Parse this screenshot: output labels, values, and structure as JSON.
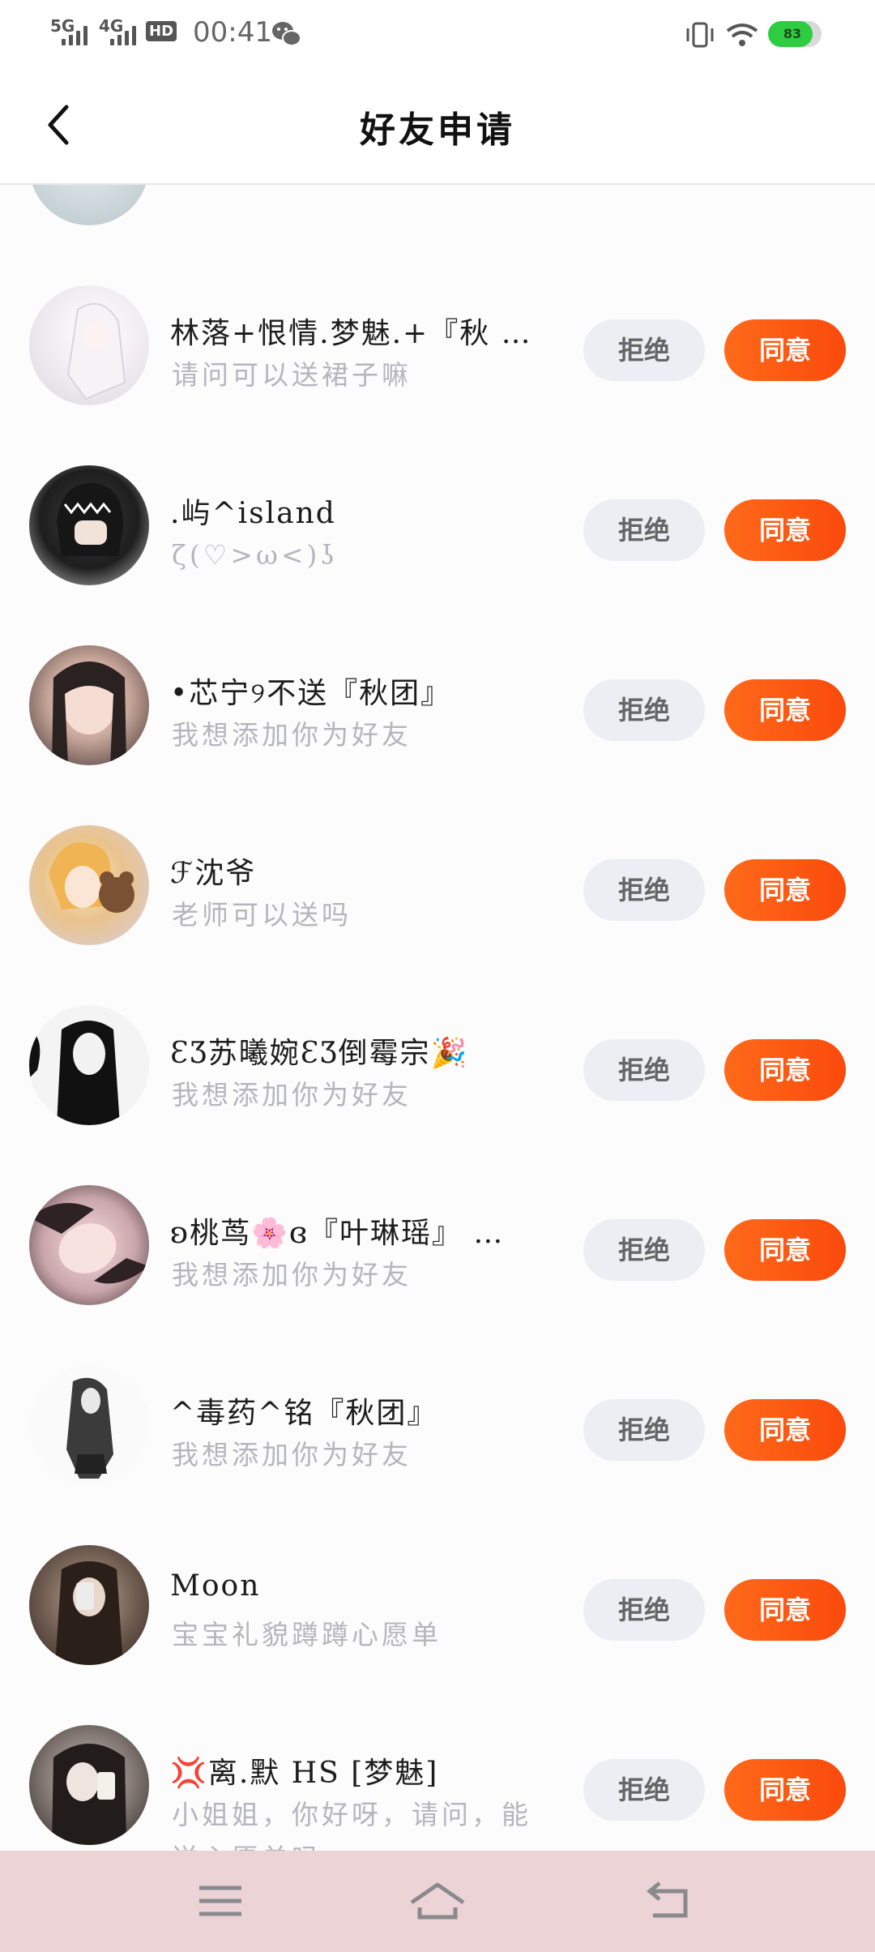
{
  "status_bar": {
    "net1": "5G",
    "net2": "4G",
    "hd": "HD",
    "time": "00:41",
    "battery_level": 83,
    "battery_label": "83",
    "battery_color": "#2ecc40"
  },
  "header": {
    "title": "好友申请"
  },
  "buttons": {
    "reject": "拒绝",
    "accept": "同意"
  },
  "colors": {
    "accent": "#fa4a0c",
    "reject_bg": "#eceef4",
    "navbar_bg": "#ecd3d6"
  },
  "requests": [
    {
      "name": "林落+恨情.梦魅.+『秋 …",
      "message": "请问可以送裙子嘛"
    },
    {
      "name": ".屿^island",
      "message": "ζ(♡>ω<)ʖ"
    },
    {
      "name": "•芯宁୨不送『秋团』",
      "message": "我想添加你为好友"
    },
    {
      "name": "ℱ沈爷",
      "message": "老师可以送吗"
    },
    {
      "name": "ƐƷ苏曦婉ƐƷ倒霉宗🎉",
      "message": "我想添加你为好友"
    },
    {
      "name": "ʚ桃茑🌸ɞ『叶琳瑶』 …",
      "message": "我想添加你为好友"
    },
    {
      "name": "^毒药^铭『秋团』",
      "message": "我想添加你为好友"
    },
    {
      "name": "Moon",
      "message": "宝宝礼貌蹲蹲心愿单"
    },
    {
      "name": "💢离.默 HS [梦魅]",
      "message": "小姐姐，你好呀，请问，能送心愿单吗→←"
    }
  ]
}
